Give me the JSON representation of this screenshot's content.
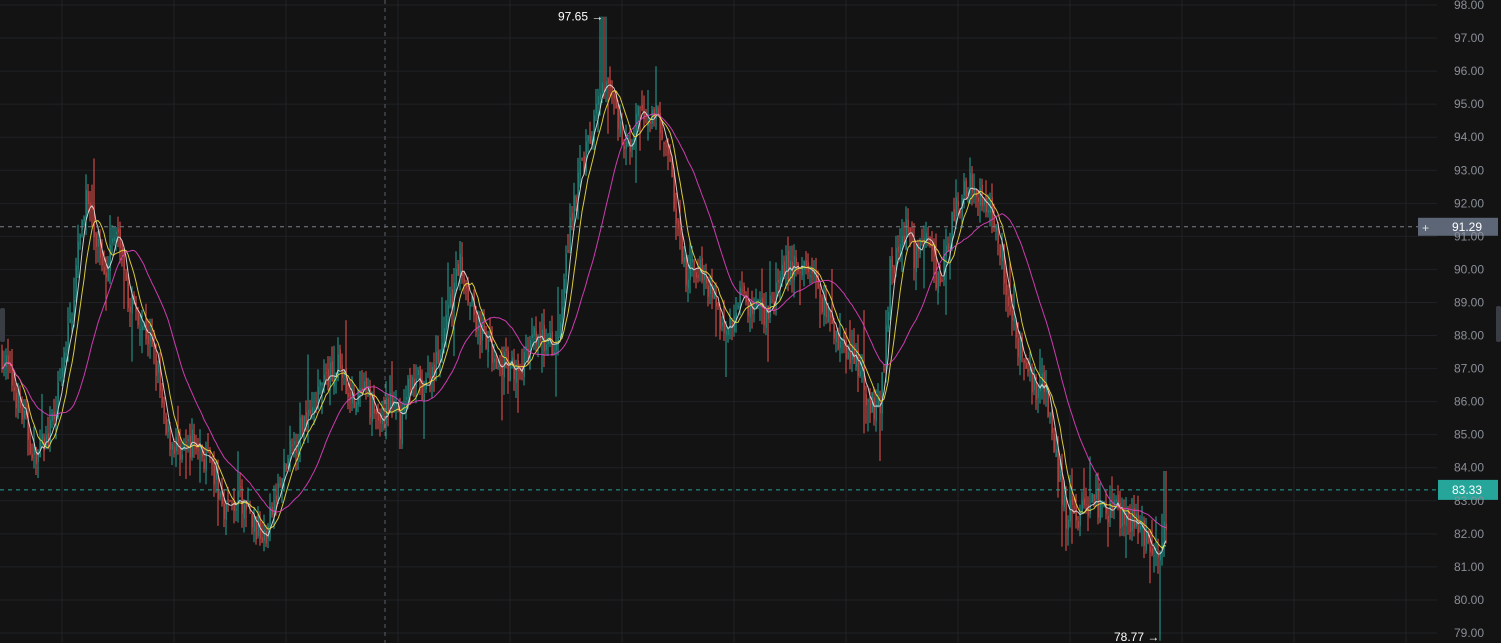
{
  "chart_data": {
    "type": "candlestick",
    "ylim": [
      79.0,
      98.0
    ],
    "y_ticks": [
      "98.00",
      "97.00",
      "96.00",
      "95.00",
      "94.00",
      "93.00",
      "92.00",
      "91.00",
      "90.00",
      "89.00",
      "88.00",
      "87.00",
      "86.00",
      "85.00",
      "84.00",
      "83.00",
      "82.00",
      "81.00",
      "80.00",
      "79.00"
    ],
    "grid": true,
    "crosshair": {
      "price_label": "91.29"
    },
    "last_price": {
      "value": 83.33,
      "label": "83.33"
    },
    "annotations": [
      {
        "text": "97.65 →",
        "value": 97.65
      },
      {
        "text": "78.77 →",
        "value": 78.77
      }
    ],
    "ma_series_colors": [
      "#e0e0e0",
      "#f0e040",
      "#e040c0"
    ],
    "colors": {
      "up": "#26a69a",
      "down": "#ef5350",
      "background": "#131313",
      "grid": "#1f2126",
      "crosshair_label_bg": "#5d6677",
      "last_price_bg": "#26a69a"
    },
    "price_path": [
      [
        0,
        87.6
      ],
      [
        10,
        86.8
      ],
      [
        22,
        85.6
      ],
      [
        35,
        84.3
      ],
      [
        50,
        85.0
      ],
      [
        60,
        86.5
      ],
      [
        72,
        88.8
      ],
      [
        85,
        92.3
      ],
      [
        95,
        91.0
      ],
      [
        105,
        90.1
      ],
      [
        118,
        91.2
      ],
      [
        125,
        89.3
      ],
      [
        140,
        88.6
      ],
      [
        150,
        87.8
      ],
      [
        158,
        86.8
      ],
      [
        165,
        85.0
      ],
      [
        180,
        84.6
      ],
      [
        195,
        84.8
      ],
      [
        210,
        84.0
      ],
      [
        225,
        82.8
      ],
      [
        240,
        83.0
      ],
      [
        255,
        82.2
      ],
      [
        265,
        81.9
      ],
      [
        275,
        83.0
      ],
      [
        290,
        84.4
      ],
      [
        305,
        85.6
      ],
      [
        320,
        86.3
      ],
      [
        338,
        87.3
      ],
      [
        350,
        85.9
      ],
      [
        365,
        86.2
      ],
      [
        380,
        85.4
      ],
      [
        390,
        86.0
      ],
      [
        400,
        85.3
      ],
      [
        410,
        86.7
      ],
      [
        425,
        86.4
      ],
      [
        440,
        87.6
      ],
      [
        450,
        88.9
      ],
      [
        460,
        90.3
      ],
      [
        470,
        89.2
      ],
      [
        480,
        88.0
      ],
      [
        492,
        87.5
      ],
      [
        505,
        87.1
      ],
      [
        520,
        87.0
      ],
      [
        535,
        87.9
      ],
      [
        550,
        87.7
      ],
      [
        560,
        88.3
      ],
      [
        570,
        91.5
      ],
      [
        580,
        93.0
      ],
      [
        590,
        93.8
      ],
      [
        600,
        95.3
      ],
      [
        610,
        95.5
      ],
      [
        620,
        94.2
      ],
      [
        630,
        93.9
      ],
      [
        640,
        94.7
      ],
      [
        650,
        94.8
      ],
      [
        660,
        94.5
      ],
      [
        668,
        93.8
      ],
      [
        675,
        91.5
      ],
      [
        685,
        89.8
      ],
      [
        700,
        90.1
      ],
      [
        715,
        89.2
      ],
      [
        725,
        88.0
      ],
      [
        740,
        89.2
      ],
      [
        755,
        88.6
      ],
      [
        770,
        88.8
      ],
      [
        785,
        90.0
      ],
      [
        800,
        90.1
      ],
      [
        815,
        89.8
      ],
      [
        825,
        88.8
      ],
      [
        840,
        87.8
      ],
      [
        855,
        87.2
      ],
      [
        870,
        86.0
      ],
      [
        880,
        85.6
      ],
      [
        890,
        90.0
      ],
      [
        905,
        91.2
      ],
      [
        915,
        90.3
      ],
      [
        925,
        91.4
      ],
      [
        935,
        89.8
      ],
      [
        945,
        90.2
      ],
      [
        955,
        91.8
      ],
      [
        965,
        92.5
      ],
      [
        975,
        92.6
      ],
      [
        985,
        92.0
      ],
      [
        995,
        91.5
      ],
      [
        1005,
        89.8
      ],
      [
        1015,
        88.0
      ],
      [
        1025,
        87.0
      ],
      [
        1035,
        86.5
      ],
      [
        1045,
        86.4
      ],
      [
        1055,
        84.5
      ],
      [
        1065,
        82.6
      ],
      [
        1080,
        82.6
      ],
      [
        1090,
        83.0
      ],
      [
        1105,
        82.8
      ],
      [
        1120,
        82.6
      ],
      [
        1135,
        82.2
      ],
      [
        1150,
        81.8
      ],
      [
        1160,
        81.6
      ],
      [
        1166,
        82.2
      ]
    ]
  }
}
